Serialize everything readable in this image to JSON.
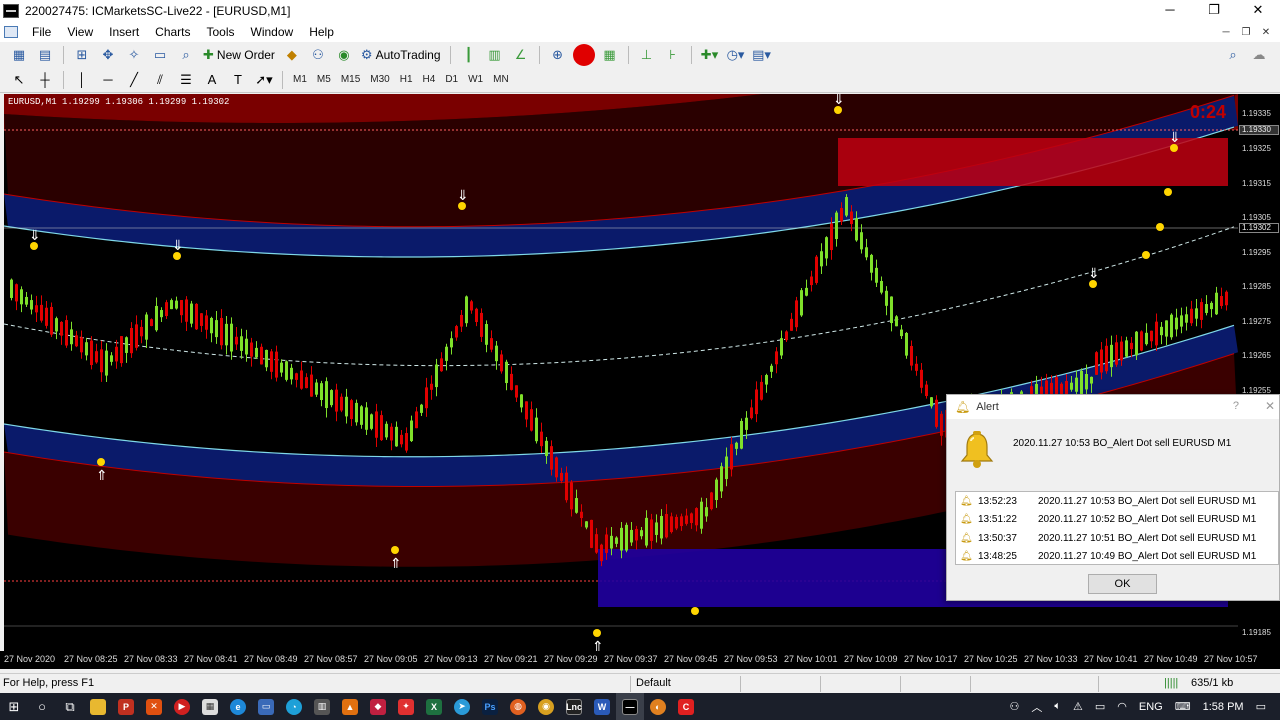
{
  "window": {
    "title": "220027475: ICMarketsSC-Live22 - [EURUSD,M1]",
    "minimize": "─",
    "restore": "❐",
    "close": "✕"
  },
  "menu": [
    "File",
    "View",
    "Insert",
    "Charts",
    "Tools",
    "Window",
    "Help"
  ],
  "toolbar": {
    "new_order": "New Order",
    "autotrading": "AutoTrading"
  },
  "timeframes": [
    "M1",
    "M5",
    "M15",
    "M30",
    "H1",
    "H4",
    "D1",
    "W1",
    "MN"
  ],
  "chart": {
    "header": "EURUSD,M1  1.19299 1.19306 1.19299 1.19302",
    "timer": "0:24",
    "price_labels": [
      "1.19335",
      "1.19330",
      "1.19325",
      "1.19315",
      "1.19305",
      "1.19302",
      "1.19295",
      "1.19285",
      "1.19275",
      "1.19265",
      "1.19255",
      "1.19185"
    ],
    "current_price": "1.19302",
    "time_labels": [
      "27 Nov 2020",
      "27 Nov 08:25",
      "27 Nov 08:33",
      "27 Nov 08:41",
      "27 Nov 08:49",
      "27 Nov 08:57",
      "27 Nov 09:05",
      "27 Nov 09:13",
      "27 Nov 09:21",
      "27 Nov 09:29",
      "27 Nov 09:37",
      "27 Nov 09:45",
      "27 Nov 09:53",
      "27 Nov 10:01",
      "27 Nov 10:09",
      "27 Nov 10:17",
      "27 Nov 10:25",
      "27 Nov 10:33",
      "27 Nov 10:41",
      "27 Nov 10:49",
      "27 Nov 10:57"
    ],
    "colors": {
      "bull": "#7fe02a",
      "bear": "#e00000",
      "band_red": "#5a0000",
      "band_blue": "#0a1a6a",
      "signal": "#ffd500"
    }
  },
  "alert": {
    "title": "Alert",
    "help": "?",
    "close": "✕",
    "message": "2020.11.27 10:53 BO_Alert Dot sell EURUSD M1",
    "rows": [
      {
        "time": "13:52:23",
        "msg": "2020.11.27 10:53 BO_Alert Dot sell EURUSD M1"
      },
      {
        "time": "13:51:22",
        "msg": "2020.11.27 10:52 BO_Alert Dot sell EURUSD M1"
      },
      {
        "time": "13:50:37",
        "msg": "2020.11.27 10:51 BO_Alert Dot sell EURUSD M1"
      },
      {
        "time": "13:48:25",
        "msg": "2020.11.27 10:49 BO_Alert Dot sell EURUSD M1"
      }
    ],
    "ok": "OK"
  },
  "status": {
    "help": "For Help, press F1",
    "profile": "Default",
    "traffic": "635/1 kb"
  },
  "tray": {
    "lang": "ENG",
    "time": "1:58 PM"
  }
}
